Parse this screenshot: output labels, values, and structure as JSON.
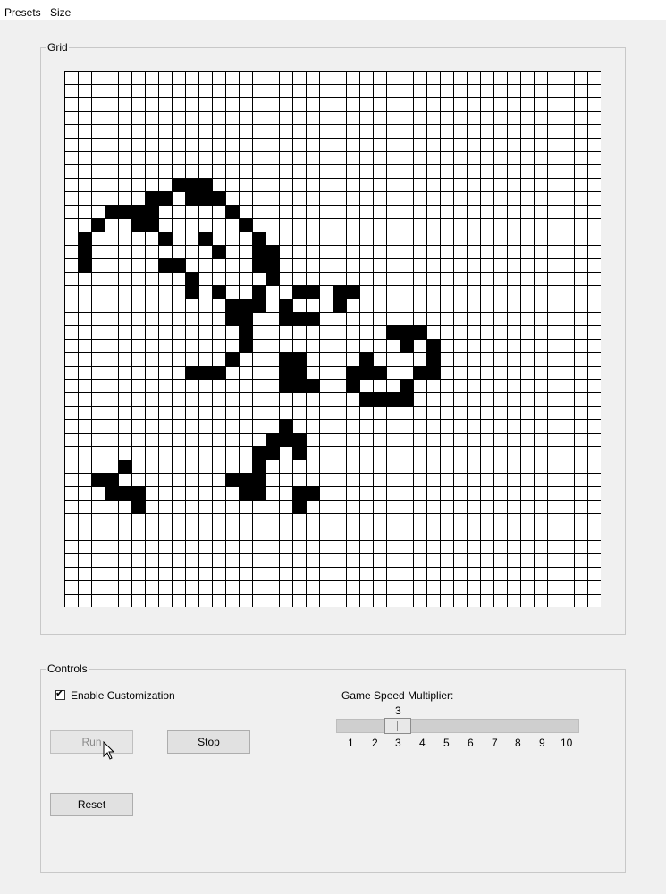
{
  "menu": {
    "items": [
      {
        "label": "Presets"
      },
      {
        "label": "Size"
      }
    ]
  },
  "grid_section": {
    "title": "Grid",
    "rows": 40,
    "cols": 40,
    "alive_cells": [
      [
        8,
        8
      ],
      [
        8,
        9
      ],
      [
        8,
        10
      ],
      [
        9,
        6
      ],
      [
        9,
        7
      ],
      [
        9,
        9
      ],
      [
        9,
        10
      ],
      [
        9,
        11
      ],
      [
        10,
        3
      ],
      [
        10,
        4
      ],
      [
        10,
        5
      ],
      [
        10,
        6
      ],
      [
        10,
        12
      ],
      [
        11,
        2
      ],
      [
        11,
        5
      ],
      [
        11,
        6
      ],
      [
        11,
        13
      ],
      [
        12,
        1
      ],
      [
        12,
        7
      ],
      [
        12,
        10
      ],
      [
        12,
        14
      ],
      [
        13,
        1
      ],
      [
        13,
        11
      ],
      [
        13,
        14
      ],
      [
        13,
        15
      ],
      [
        14,
        1
      ],
      [
        14,
        7
      ],
      [
        14,
        8
      ],
      [
        14,
        14
      ],
      [
        14,
        15
      ],
      [
        15,
        9
      ],
      [
        15,
        15
      ],
      [
        16,
        9
      ],
      [
        16,
        11
      ],
      [
        16,
        14
      ],
      [
        16,
        17
      ],
      [
        16,
        18
      ],
      [
        16,
        20
      ],
      [
        16,
        21
      ],
      [
        17,
        12
      ],
      [
        17,
        13
      ],
      [
        17,
        14
      ],
      [
        17,
        16
      ],
      [
        17,
        20
      ],
      [
        18,
        12
      ],
      [
        18,
        13
      ],
      [
        18,
        16
      ],
      [
        18,
        17
      ],
      [
        18,
        18
      ],
      [
        19,
        13
      ],
      [
        19,
        24
      ],
      [
        19,
        25
      ],
      [
        19,
        26
      ],
      [
        20,
        13
      ],
      [
        20,
        25
      ],
      [
        20,
        27
      ],
      [
        21,
        12
      ],
      [
        21,
        16
      ],
      [
        21,
        17
      ],
      [
        21,
        22
      ],
      [
        21,
        27
      ],
      [
        22,
        9
      ],
      [
        22,
        10
      ],
      [
        22,
        11
      ],
      [
        22,
        16
      ],
      [
        22,
        17
      ],
      [
        22,
        21
      ],
      [
        22,
        22
      ],
      [
        22,
        23
      ],
      [
        22,
        26
      ],
      [
        22,
        27
      ],
      [
        23,
        16
      ],
      [
        23,
        17
      ],
      [
        23,
        18
      ],
      [
        23,
        21
      ],
      [
        23,
        25
      ],
      [
        24,
        22
      ],
      [
        24,
        23
      ],
      [
        24,
        24
      ],
      [
        24,
        25
      ],
      [
        26,
        16
      ],
      [
        27,
        15
      ],
      [
        27,
        16
      ],
      [
        27,
        17
      ],
      [
        28,
        14
      ],
      [
        28,
        15
      ],
      [
        28,
        17
      ],
      [
        29,
        4
      ],
      [
        29,
        14
      ],
      [
        30,
        2
      ],
      [
        30,
        3
      ],
      [
        30,
        12
      ],
      [
        30,
        13
      ],
      [
        30,
        14
      ],
      [
        31,
        3
      ],
      [
        31,
        4
      ],
      [
        31,
        5
      ],
      [
        31,
        13
      ],
      [
        31,
        14
      ],
      [
        31,
        17
      ],
      [
        31,
        18
      ],
      [
        32,
        5
      ],
      [
        32,
        17
      ]
    ]
  },
  "controls": {
    "title": "Controls",
    "enable_customization": {
      "label": "Enable Customization",
      "checked": true
    },
    "run_button": {
      "label": "Run",
      "enabled": false
    },
    "stop_button": {
      "label": "Stop"
    },
    "reset_button": {
      "label": "Reset"
    },
    "speed": {
      "label": "Game Speed Multiplier:",
      "value": "3",
      "ticks": [
        "1",
        "2",
        "3",
        "4",
        "5",
        "6",
        "7",
        "8",
        "9",
        "10"
      ]
    }
  }
}
